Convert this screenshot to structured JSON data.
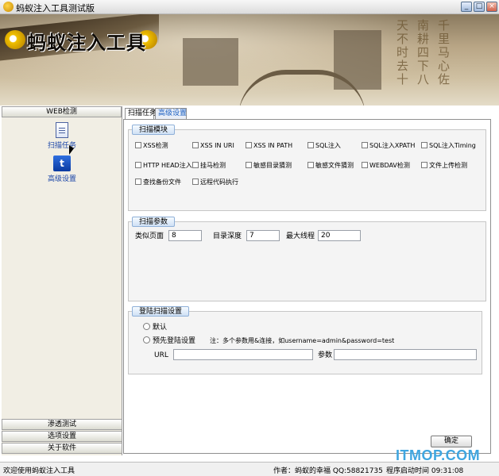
{
  "window": {
    "title": "蚂蚁注入工具测试版",
    "min_label": "_",
    "max_label": "□",
    "close_label": "×"
  },
  "banner": {
    "logo_text": "蚂蚁注入工具",
    "calligraphy": [
      "千里马心佐",
      "南耕四下八",
      "天不时去十"
    ]
  },
  "sidebar": {
    "header": "WEB检测",
    "items": [
      {
        "label": "扫描任务",
        "icon": "document-icon"
      },
      {
        "label": "高级设置",
        "icon": "settings-icon"
      }
    ],
    "bottom": [
      "渗透测试",
      "选项设置",
      "关于软件"
    ]
  },
  "tabs": [
    "扫描任务",
    "高级设置"
  ],
  "scan_module": {
    "title": "扫描模块",
    "options": [
      "XSS检测",
      "XSS IN URI",
      "XSS IN PATH",
      "SQL注入",
      "SQL注入XPATH",
      "SQL注入Timing",
      "HTTP HEAD注入",
      "挂马检测",
      "敏感目录猜测",
      "敏感文件猜测",
      "WEBDAV检测",
      "文件上传检测",
      "查找备份文件",
      "远程代码执行"
    ]
  },
  "scan_params": {
    "title": "扫描参数",
    "similar_pages_label": "类似页面",
    "similar_pages_value": "8",
    "dir_depth_label": "目录深度",
    "dir_depth_value": "7",
    "max_threads_label": "最大线程",
    "max_threads_value": "20"
  },
  "login": {
    "title": "登陆扫描设置",
    "default_label": "默认",
    "prelogin_label": "预先登陆设置",
    "note": "注：多个参数用&连接，如username=admin&password=test",
    "url_label": "URL",
    "url_value": "",
    "param_label": "参数",
    "param_value": ""
  },
  "ok_label": "确定",
  "status": {
    "welcome": "欢迎使用蚂蚁注入工具",
    "author": "作者：蚂蚁的幸福  QQ:58821735",
    "runtime": "程序启动时间 09:31:08"
  },
  "watermark": "ITMOP.COM"
}
